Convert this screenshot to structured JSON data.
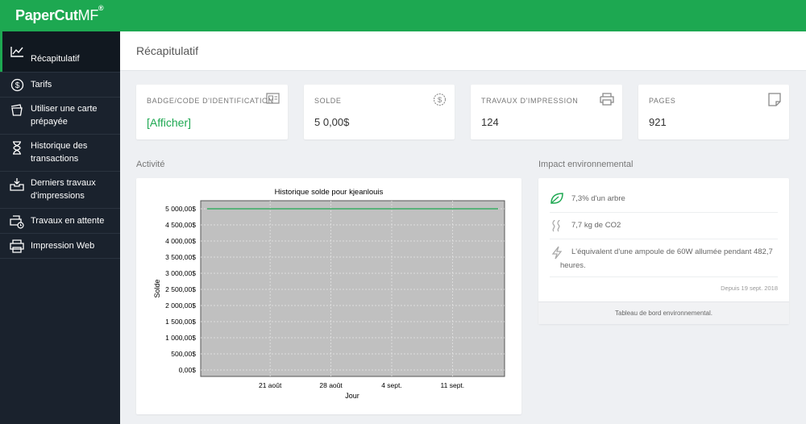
{
  "app": {
    "logo_text": "PaperCut",
    "logo_suffix": "MF",
    "logo_mark": "®"
  },
  "sidebar": {
    "items": [
      {
        "label": "Récapitulatif",
        "icon": "line-chart-icon",
        "active": true
      },
      {
        "label": "Tarifs",
        "icon": "dollar-circle-icon",
        "active": false
      },
      {
        "label": "Utiliser une carte prépayée",
        "icon": "card-stack-icon",
        "active": false
      },
      {
        "label": "Historique des transactions",
        "icon": "hourglass-icon",
        "active": false
      },
      {
        "label": "Derniers travaux d'impressions",
        "icon": "inbox-tray-icon",
        "active": false
      },
      {
        "label": "Travaux en attente",
        "icon": "print-hold-icon",
        "active": false
      },
      {
        "label": "Impression Web",
        "icon": "web-print-icon",
        "active": false
      }
    ]
  },
  "page": {
    "title": "Récapitulatif"
  },
  "summary_cards": {
    "badge": {
      "label": "BADGE/CODE D'IDENTIFICATION",
      "bracket_open": "[",
      "link": "Afficher",
      "bracket_close": "]",
      "icon": "id-card-icon"
    },
    "balance": {
      "label": "SOLDE",
      "value": "5 0,00$",
      "icon": "dollar-circle-icon"
    },
    "jobs": {
      "label": "TRAVAUX D'IMPRESSION",
      "value": "124",
      "icon": "printer-icon"
    },
    "pages": {
      "label": "PAGES",
      "value": "921",
      "icon": "page-icon"
    }
  },
  "activity": {
    "title": "Activité"
  },
  "chart_data": {
    "type": "line",
    "title": "Historique solde pour kjeanlouis",
    "xlabel": "Jour",
    "ylabel": "Solde",
    "y_ticks": [
      "0,00$",
      "500,00$",
      "1 000,00$",
      "1 500,00$",
      "2 000,00$",
      "2 500,00$",
      "3 000,00$",
      "3 500,00$",
      "4 000,00$",
      "4 500,00$",
      "5 000,00$"
    ],
    "x_ticks": [
      "21 août",
      "28 août",
      "4 sept.",
      "11 sept."
    ],
    "ylim": [
      0,
      5000
    ],
    "grid": true,
    "background": "#c0c0c0",
    "series": [
      {
        "color": "#1da851",
        "x": [
          "2018-08-13",
          "2018-09-17"
        ],
        "y": [
          5000,
          5000
        ]
      }
    ]
  },
  "environment": {
    "title": "Impact environnemental",
    "items": [
      {
        "icon": "leaf-icon",
        "text": "7,3% d'un arbre"
      },
      {
        "icon": "smoke-icon",
        "text": "7,7 kg de CO2"
      },
      {
        "icon": "lightning-icon",
        "text": "L'équivalent d'une ampoule de 60W allumée pendant 482,7 heures."
      }
    ],
    "since": "Depuis 19 sept. 2018",
    "footer_link": "Tableau de bord environnemental."
  },
  "colors": {
    "accent": "#1da851",
    "sidebar": "#1a222d",
    "background": "#eef0f3"
  }
}
